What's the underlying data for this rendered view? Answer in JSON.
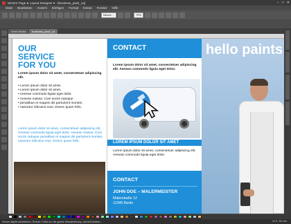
{
  "window": {
    "title": "MAGIX Page & Layout Designer 9 - [business_pack_1a]",
    "controls": [
      "–",
      "□",
      "✕"
    ]
  },
  "menu": {
    "items": [
      "Datei",
      "Bearbeiten",
      "Ansicht",
      "Einfügen",
      "Format",
      "Extras",
      "Fenster",
      "Hilfe"
    ]
  },
  "toolbar": {
    "object_select": "Neues ...",
    "zoom_select": "75%"
  },
  "tabs": [
    {
      "label": "Seite Media",
      "active": false
    },
    {
      "label": "business_pack_1a",
      "active": true
    }
  ],
  "document": {
    "left": {
      "title_line1": "OUR",
      "title_line2": "SERVICE",
      "title_line3": "FOR YOU",
      "intro_bold": "Lorem ipsum dolor sit amet, consectetuer adipiscing elit.",
      "bullets": [
        "Lorem ipsum dolor sit amet,",
        "Lorem ipsum dolor sit amet,",
        "Aenean commodo ligula eget dolor.",
        "Aenean massa. Cum sociis natoque",
        "penatibus et magnis dis parturient montes,",
        "nascetur ridiculus mus. Donec quam felis,"
      ],
      "blue_paragraph": "Lorem ipsum dolor sit amet, consectetuer adipiscing elit. Aenean commodo ligula eget dolor. Aenean massa. Cum sociis natoque penatibus et magnis dis parturient montes, nascetur ridiculus mus. Donec quam felis,"
    },
    "middle": {
      "contact_title": "CONTACT",
      "intro_bold": "Lorem ipsum dolor sit amet, consectetuer adipiscing elit. Aenean commodo ligula eget dolor.",
      "stripe_text": "LOREM IPSUM DOLOR SIT AMET",
      "stripe_para": "Lorem ipsum dolor sit amet, consectetuer adipiscing elit. Aenean commodo ligula eget dolor.",
      "box_title": "CONTACT",
      "name": "JOHN DOE – MALERMEISTER",
      "street": "Malerstraße 12",
      "city": "12345 Berlin"
    },
    "right": {
      "headline": "hello paints"
    }
  },
  "status": {
    "left": "Neues objekt selektieren: Drücke 2 Mal um die ganze Visualisierung, schnell ändern...",
    "right": "12,5, 35 mm"
  },
  "palette": {
    "swatches": [
      "#ffffff",
      "#000000",
      "#c0c0c0",
      "#808080",
      "#ff0000",
      "#800000",
      "#ffff00",
      "#808000",
      "#00ff00",
      "#008000",
      "#00ffff",
      "#008080",
      "#0000ff",
      "#000080",
      "#ff00ff",
      "#800080",
      "#ff8000",
      "#804000",
      "#ff80c0",
      "#80ff80",
      "#80ffff",
      "#8080ff",
      "#c0c0ff",
      "#ffc080",
      "#c08040",
      "#404040",
      "#e6e6e6",
      "#1e8fd8",
      "#2ca02c",
      "#d62728",
      "#9467bd",
      "#8c564b",
      "#e377c2",
      "#7f7f7f",
      "#bcbd22",
      "#17becf",
      "#ff9896",
      "#98df8a",
      "#aec7e8",
      "#ffbb78"
    ]
  },
  "colors": {
    "accent_blue": "#1e8fd8"
  }
}
